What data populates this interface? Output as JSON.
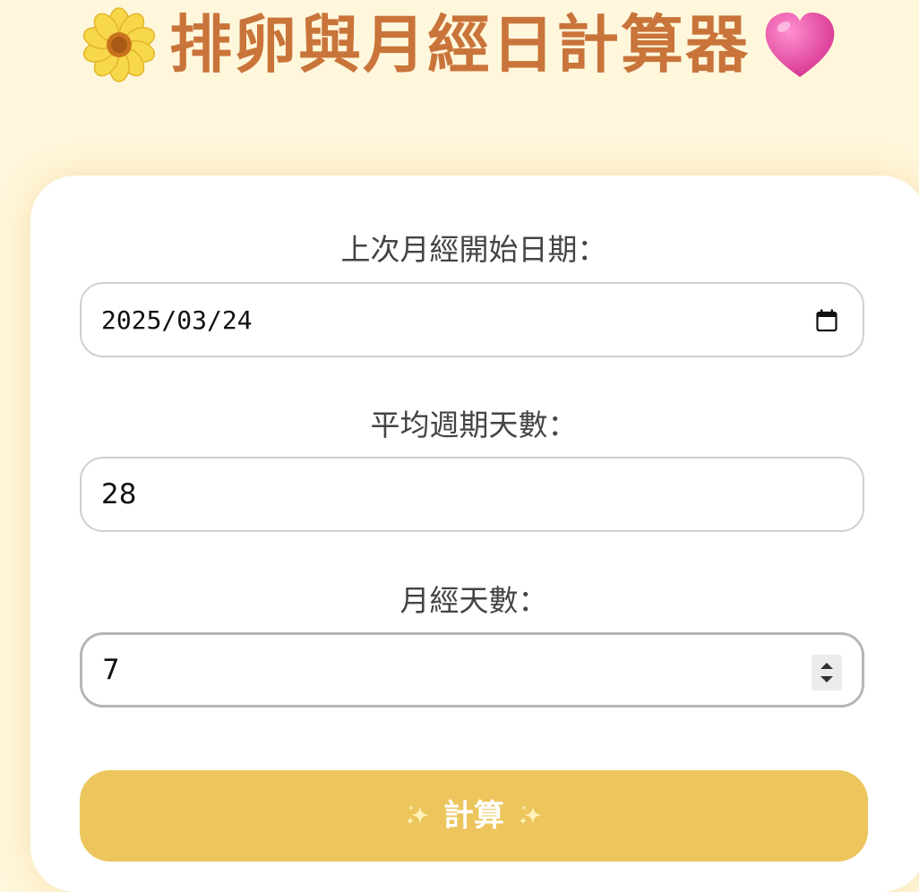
{
  "header": {
    "title": "排卵與月經日計算器",
    "left_icon": "sunflower-icon",
    "right_icon": "heart-icon"
  },
  "form": {
    "last_period_label": "上次月經開始日期：",
    "last_period_value": "2025/03/24",
    "cycle_label": "平均週期天數：",
    "cycle_value": "28",
    "period_days_label": "月經天數：",
    "period_days_value": "7",
    "calculate_button": "計算"
  },
  "colors": {
    "background": "#fff7dc",
    "title": "#c9743a",
    "button": "#ecc55c",
    "label": "#444444"
  }
}
